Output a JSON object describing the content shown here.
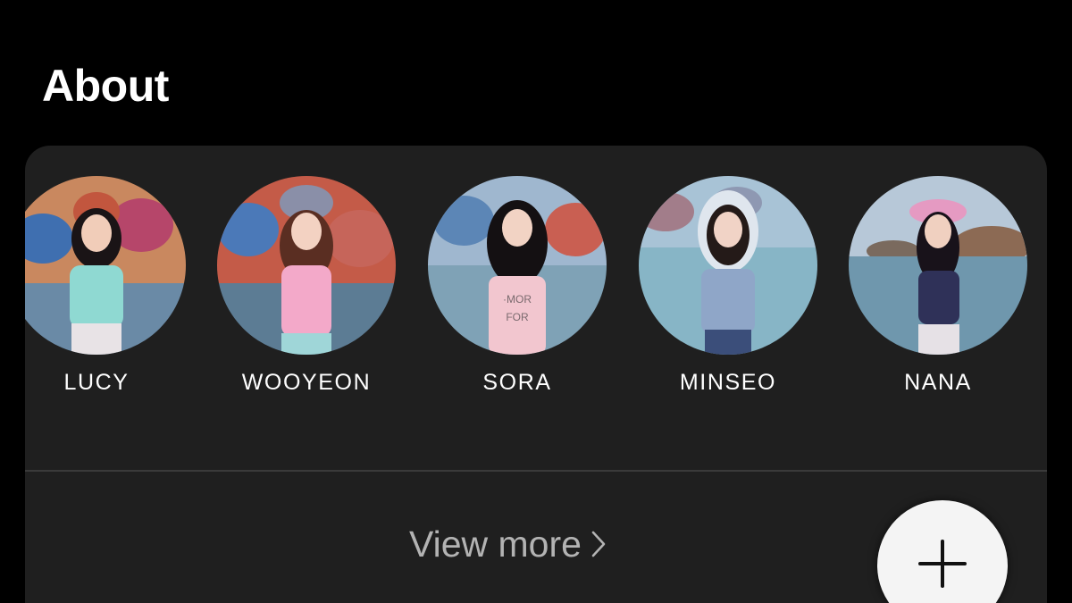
{
  "section": {
    "title": "About"
  },
  "members": [
    {
      "name": "LUCY",
      "top_color": "#8fd9d2",
      "hair_color": "#1a1416"
    },
    {
      "name": "WOOYEON",
      "top_color": "#f3a9c9",
      "hair_color": "#5a2e22"
    },
    {
      "name": "SORA",
      "top_color": "#f2c6cf",
      "hair_color": "#141012"
    },
    {
      "name": "MINSEO",
      "top_color": "#8fa6c8",
      "hair_color": "#241a18"
    },
    {
      "name": "NANA",
      "top_color": "#2f3158",
      "hair_color": "#18121a"
    }
  ],
  "footer": {
    "view_more_label": "View more",
    "view_more_icon": "chevron-right-icon",
    "fab_icon": "plus-icon"
  },
  "colors": {
    "background": "#000000",
    "card": "#1f1f1f",
    "divider": "#3a3a3a",
    "text_primary": "#ffffff",
    "text_secondary": "#b3b3b3",
    "fab": "#f4f4f4"
  }
}
